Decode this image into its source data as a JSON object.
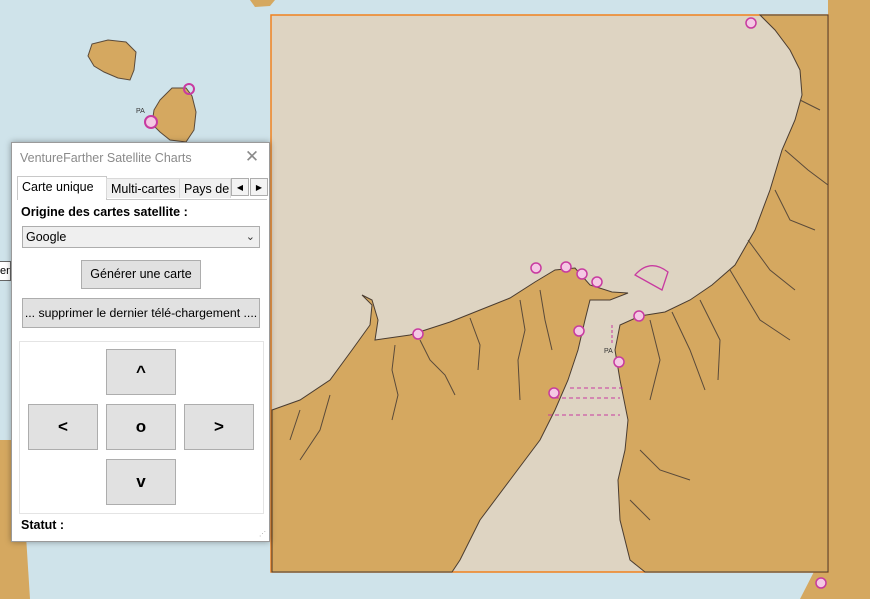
{
  "window": {
    "title": "VentureFarther Satellite Charts"
  },
  "tabs": [
    {
      "label": "Carte unique",
      "active": true
    },
    {
      "label": "Multi-cartes",
      "active": false
    },
    {
      "label": "Pays de c",
      "active": false
    }
  ],
  "panel": {
    "origin_label": "Origine des cartes satellite :",
    "origin_selected": "Google",
    "generate_label": "Générer une carte",
    "delete_label": "... supprimer le dernier télé-chargement ....",
    "nav": {
      "up": "^",
      "left": "<",
      "center": "o",
      "right": ">",
      "down": "v"
    },
    "status_label": "Statut :"
  },
  "map": {
    "labels": {
      "pa_north": "PA",
      "pa_strait": "PA",
      "edge": "ent"
    },
    "colors": {
      "water": "#cfe3ea",
      "land": "#d5a860",
      "selection_fill": "#ded4c2",
      "selection_border": "#f0821e",
      "marker": "#c83aa0"
    }
  },
  "icons": {
    "close": "close-icon",
    "tab_prev": "tab-prev-icon",
    "tab_next": "tab-next-icon",
    "dropdown": "chevron-down-icon"
  }
}
